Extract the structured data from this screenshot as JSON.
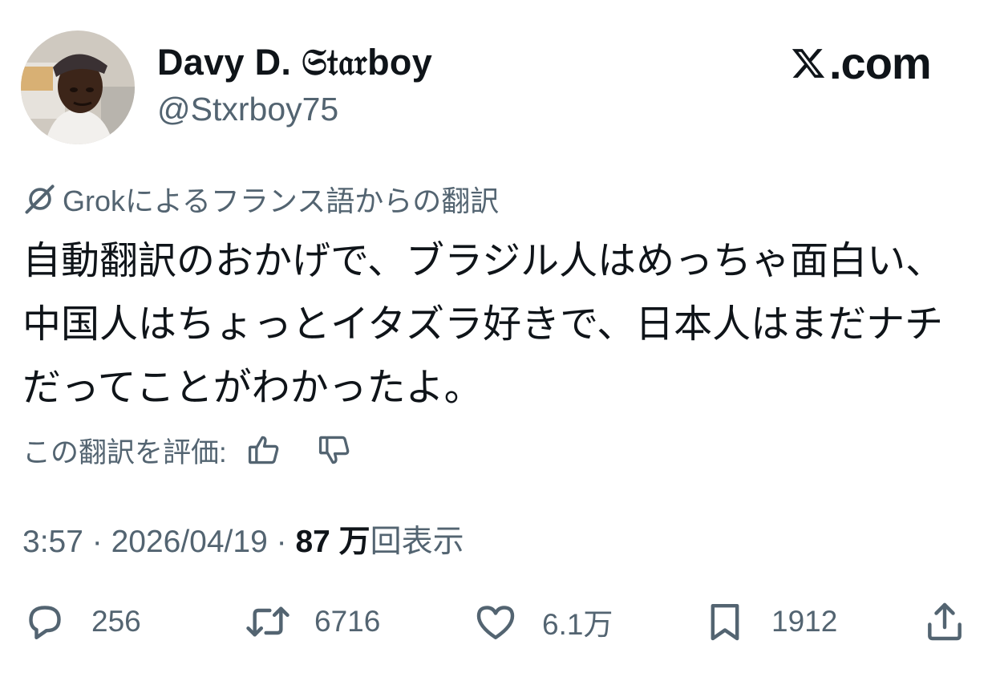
{
  "author": {
    "display_name": "Davy D. 𝔖𝔱𝔞𝔯boy",
    "handle": "@Stxrboy75"
  },
  "site_badge": {
    "icon": "x-logo-icon",
    "label": ".com"
  },
  "translation": {
    "label": "Grokによるフランス語からの翻訳",
    "icon": "grok-icon"
  },
  "tweet": {
    "text": "自動翻訳のおかげで、ブラジル人はめっちゃ面白い、中国人はちょっとイタズラ好きで、日本人はまだナチだってことがわかったよ。"
  },
  "rating": {
    "label": "この翻訳を評価:",
    "up_icon": "thumbs-up-icon",
    "down_icon": "thumbs-down-icon"
  },
  "meta": {
    "time": "3:57",
    "sep1": " · ",
    "date": "2026/04/19",
    "sep2": " · ",
    "views_count": "87 万",
    "views_label": "回表示"
  },
  "actions": {
    "replies": "256",
    "reposts": "6716",
    "likes": "6.1万",
    "bookmarks": "1912"
  },
  "colors": {
    "text": "#0f1419",
    "secondary": "#536471",
    "background": "#ffffff"
  }
}
